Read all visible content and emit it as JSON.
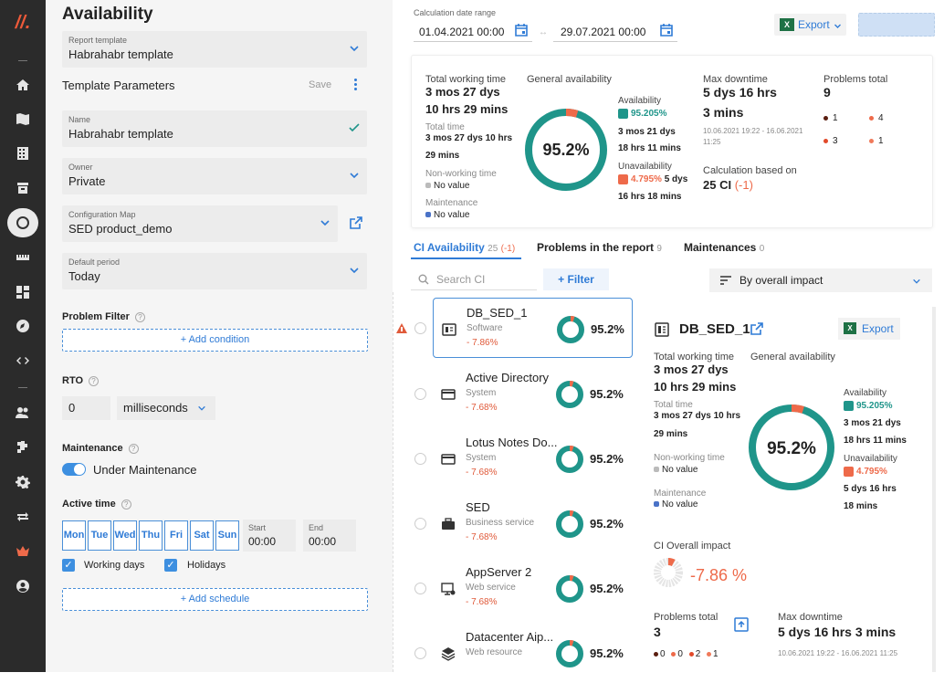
{
  "sidebar": {
    "logo": "//."
  },
  "left": {
    "title": "Availability",
    "report_template": {
      "label": "Report template",
      "value": "Habrahabr template"
    },
    "template_params": {
      "label": "Template Parameters",
      "save": "Save"
    },
    "name": {
      "label": "Name",
      "value": "Habrahabr template"
    },
    "owner": {
      "label": "Owner",
      "value": "Private"
    },
    "config_map": {
      "label": "Configuration Map",
      "value": "SED product_demo"
    },
    "default_period": {
      "label": "Default period",
      "value": "Today"
    },
    "problem_filter": {
      "label": "Problem Filter",
      "add": "+ Add condition"
    },
    "rto": {
      "label": "RTO",
      "value": "0",
      "unit": "milliseconds"
    },
    "maintenance": {
      "label": "Maintenance",
      "toggle": "Under Maintenance"
    },
    "active_time": {
      "label": "Active time",
      "days": [
        "Mon",
        "Tue",
        "Wed",
        "Thu",
        "Fri",
        "Sat",
        "Sun"
      ],
      "start_label": "Start",
      "start": "00:00",
      "end_label": "End",
      "end": "00:00"
    },
    "working_days": "Working days",
    "holidays": "Holidays",
    "add_schedule": "+ Add schedule"
  },
  "top": {
    "range_label": "Calculation date range",
    "from": "01.04.2021 00:00",
    "to": "29.07.2021 00:00",
    "export": "Export"
  },
  "summary": {
    "twt_label": "Total working time",
    "twt1": "3 mos 27 dys",
    "twt2": "10 hrs 29 mins",
    "tt_label": "Total time",
    "tt1": "3 mos 27 dys 10 hrs",
    "tt2": "29 mins",
    "nwt_label": "Non-working time",
    "nwt_val": "No value",
    "maint_label": "Maintenance",
    "maint_val": "No value",
    "ga_label": "General availability",
    "ga_pct": "95.2%",
    "ga_value": 95.205,
    "av_label": "Availability",
    "av_pct": "95.205%",
    "av_t1": "3 mos 21 dys",
    "av_t2": "18 hrs 11 mins",
    "un_label": "Unavailability",
    "un_pct": "4.795%",
    "un_t1": "5 dys",
    "un_t2": "16 hrs 18 mins",
    "md_label": "Max downtime",
    "md1": "5 dys 16 hrs",
    "md2": "3 mins",
    "md_range1": "10.06.2021 19:22 - 16.06.2021",
    "md_range2": "11:25",
    "pt_label": "Problems total",
    "pt_val": "9",
    "p_a": "1",
    "p_b": "4",
    "p_c": "3",
    "p_d": "1",
    "cb_label": "Calculation based on",
    "cb_val": "25 CI",
    "cb_delta": "(-1)"
  },
  "tabs": [
    {
      "label": "CI Availability",
      "count": "25",
      "delta": "(-1)"
    },
    {
      "label": "Problems in the report",
      "count": "9"
    },
    {
      "label": "Maintenances",
      "count": "0"
    }
  ],
  "search": {
    "placeholder": "Search CI",
    "filter": "+ Filter",
    "sort": "By overall impact"
  },
  "ci_list": [
    {
      "name": "DB_SED_1",
      "type": "Software",
      "impact": "- 7.86%",
      "pct": "95.2%",
      "value": 95.2
    },
    {
      "name": "Active Directory",
      "type": "System",
      "impact": "- 7.68%",
      "pct": "95.2%",
      "value": 95.2
    },
    {
      "name": "Lotus Notes Do...",
      "type": "System",
      "impact": "- 7.68%",
      "pct": "95.2%",
      "value": 95.2
    },
    {
      "name": "SED",
      "type": "Business service",
      "impact": "- 7.68%",
      "pct": "95.2%",
      "value": 95.2
    },
    {
      "name": "AppServer 2",
      "type": "Web service",
      "impact": "- 7.68%",
      "pct": "95.2%",
      "value": 95.2
    },
    {
      "name": "Datacenter Aip...",
      "type": "Web resource",
      "impact": "",
      "pct": "95.2%",
      "value": 95.2
    }
  ],
  "detail": {
    "title": "DB_SED_1",
    "export": "Export",
    "twt_label": "Total working time",
    "twt1": "3 mos 27 dys",
    "twt2": "10 hrs 29 mins",
    "ga_label": "General availability",
    "tt_label": "Total time",
    "tt1": "3 mos 27 dys 10 hrs",
    "tt2": "29 mins",
    "nwt_label": "Non-working time",
    "nwt_val": "No value",
    "maint_label": "Maintenance",
    "maint_val": "No value",
    "ga_pct": "95.2%",
    "ga_value": 95.205,
    "av_label": "Availability",
    "av_pct": "95.205%",
    "av_t1": "3 mos 21 dys",
    "av_t2": "18 hrs 11 mins",
    "un_label": "Unavailability",
    "un_pct": "4.795%",
    "un_t1": "5 dys 16 hrs",
    "un_t2": "18 mins",
    "impact_label": "CI Overall impact",
    "impact_val": "-7.86 %",
    "impact_value": 7.86,
    "pt_label": "Problems total",
    "pt_val": "3",
    "p_a": "0",
    "p_b": "0",
    "p_c": "2",
    "p_d": "1",
    "md_label": "Max downtime",
    "md_val": "5 dys 16 hrs 3 mins",
    "md_range": "10.06.2021 19:22 - 16.06.2021 11:25"
  },
  "colors": {
    "teal": "#1f958a",
    "orange": "#ee6a4a",
    "blue": "#2f7bd6",
    "green_excel": "#1e7145"
  }
}
